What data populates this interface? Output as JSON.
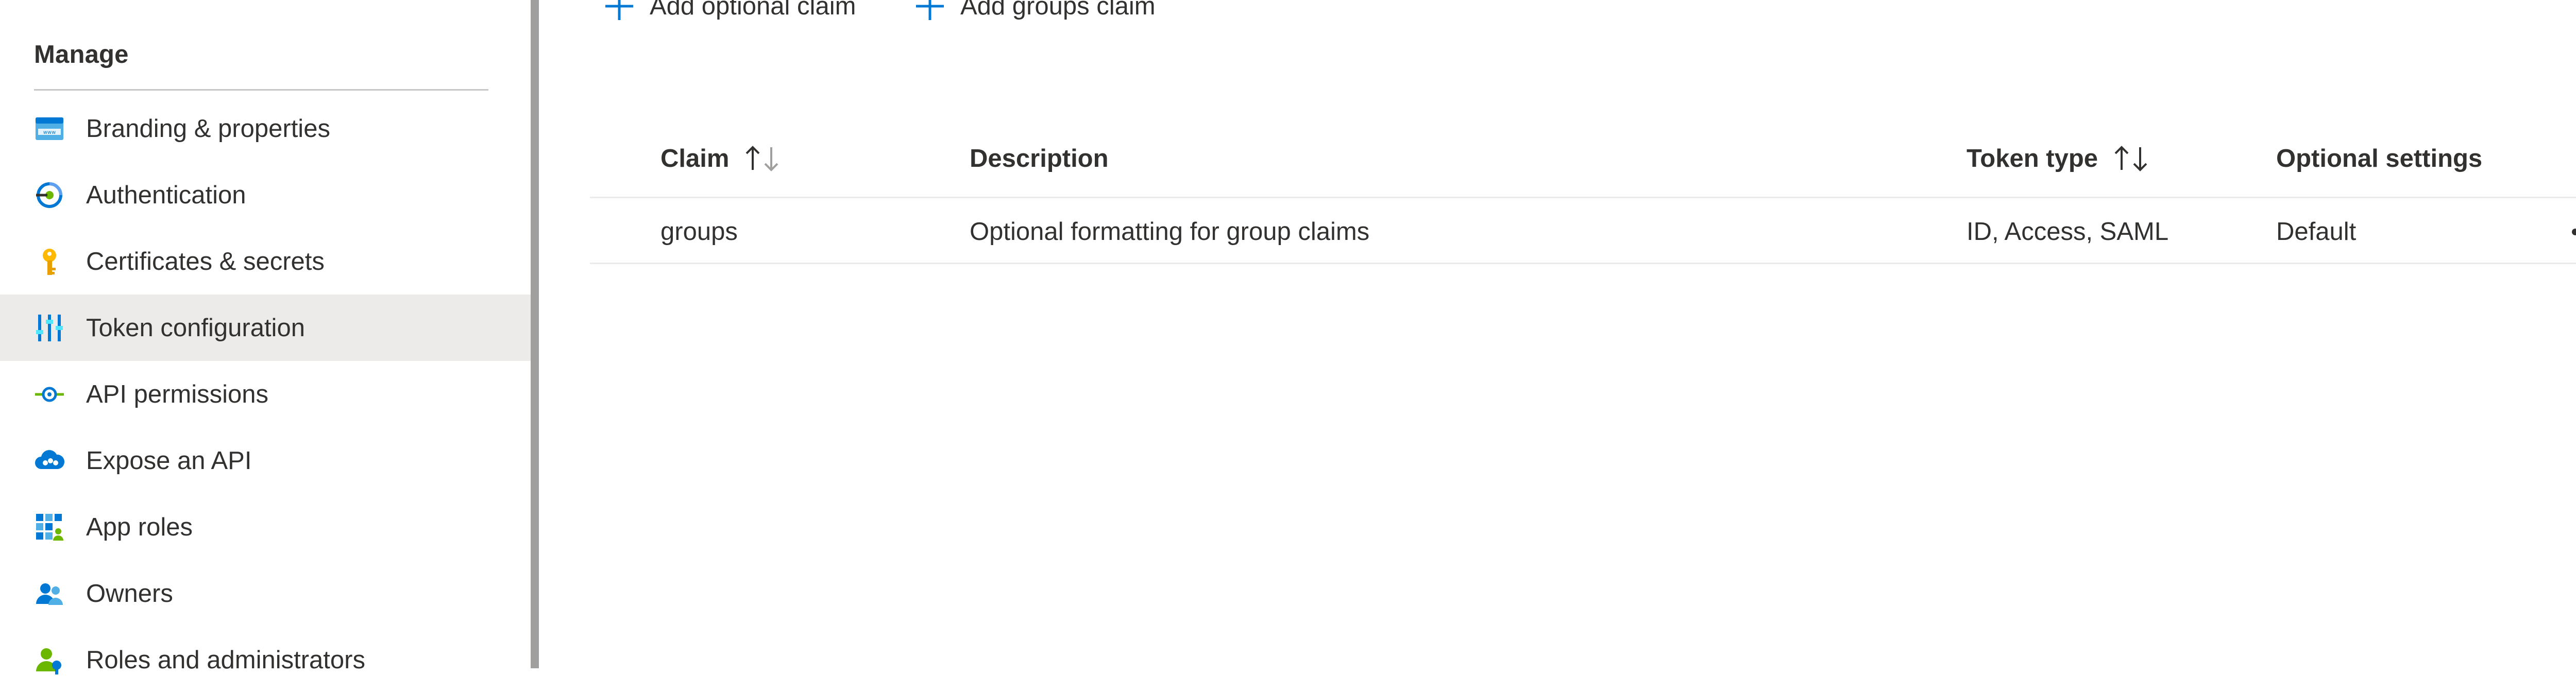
{
  "sidebar": {
    "section_title": "Manage",
    "items": [
      {
        "label": "Branding & properties",
        "icon": "branding-icon"
      },
      {
        "label": "Authentication",
        "icon": "authentication-icon"
      },
      {
        "label": "Certificates & secrets",
        "icon": "key-icon"
      },
      {
        "label": "Token configuration",
        "icon": "token-configuration-icon",
        "selected": true
      },
      {
        "label": "API permissions",
        "icon": "api-permissions-icon"
      },
      {
        "label": "Expose an API",
        "icon": "cloud-api-icon"
      },
      {
        "label": "App roles",
        "icon": "app-roles-icon"
      },
      {
        "label": "Owners",
        "icon": "owners-icon"
      },
      {
        "label": "Roles and administrators",
        "icon": "roles-admin-icon"
      }
    ]
  },
  "toolbar": {
    "add_optional_claim": "Add optional claim",
    "add_groups_claim": "Add groups claim"
  },
  "table": {
    "columns": [
      {
        "label": "Claim",
        "sortable": true
      },
      {
        "label": "Description",
        "sortable": false
      },
      {
        "label": "Token type",
        "sortable": true
      },
      {
        "label": "Optional settings",
        "sortable": false
      }
    ],
    "rows": [
      {
        "claim": "groups",
        "description": "Optional formatting for group claims",
        "token_type": "ID, Access, SAML",
        "optional_settings": "Default"
      }
    ]
  },
  "colors": {
    "accent": "#0078d4",
    "selected_bg": "#edebe9",
    "text": "#323130"
  }
}
